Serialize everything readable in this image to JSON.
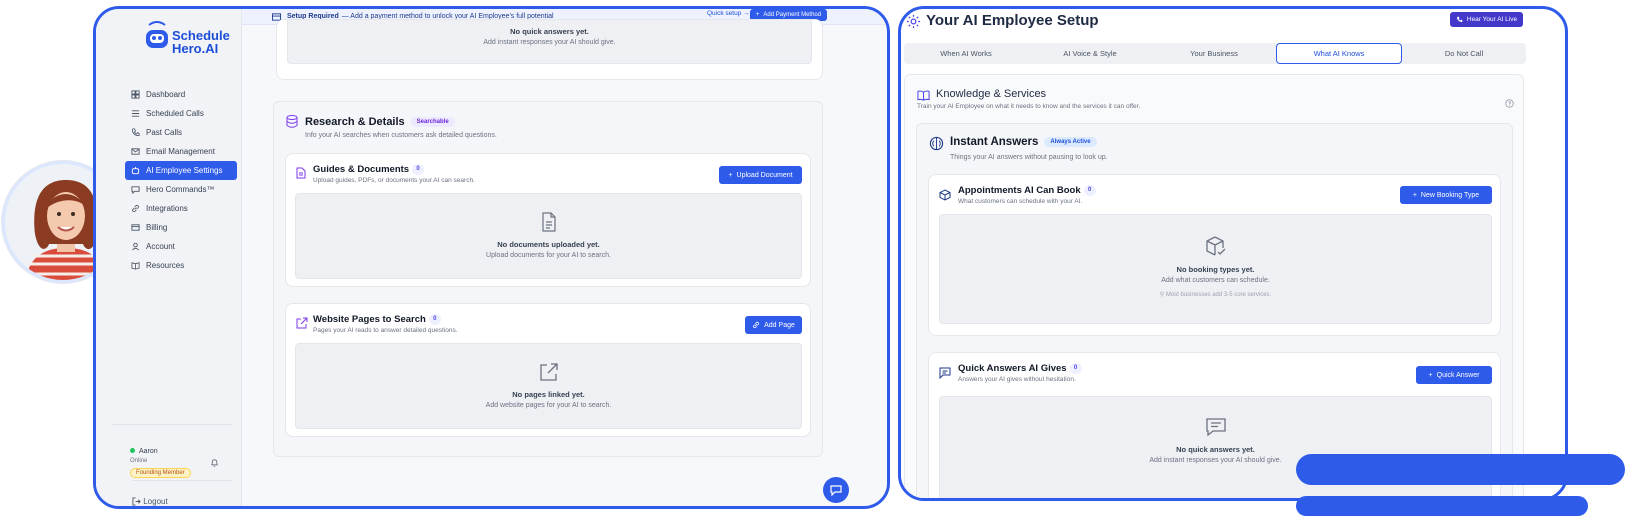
{
  "brand": {
    "line1": "Schedule",
    "line2": "Hero.AI"
  },
  "banner": {
    "title": "Setup Required",
    "text": "— Add a payment method to unlock your AI Employee's full potential",
    "quick_setup": "Quick setup →",
    "button": "Add Payment Method"
  },
  "sidebar": {
    "items": [
      {
        "label": "Dashboard",
        "icon": "dashboard-icon"
      },
      {
        "label": "Scheduled Calls",
        "icon": "list-icon"
      },
      {
        "label": "Past Calls",
        "icon": "phone-icon"
      },
      {
        "label": "Email Management",
        "icon": "mail-icon"
      },
      {
        "label": "AI Employee Settings",
        "icon": "robot-icon",
        "active": true
      },
      {
        "label": "Hero Commands™",
        "icon": "chat-icon"
      },
      {
        "label": "Integrations",
        "icon": "link-icon"
      },
      {
        "label": "Billing",
        "icon": "card-icon"
      },
      {
        "label": "Account",
        "icon": "user-icon"
      },
      {
        "label": "Resources",
        "icon": "book-icon"
      }
    ],
    "user": {
      "name": "Aaron",
      "status": "Online",
      "badge": "Founding Member"
    },
    "logout": "Logout"
  },
  "left": {
    "top_empty": {
      "title": "No quick answers yet.",
      "sub": "Add instant responses your AI should give."
    },
    "research": {
      "title": "Research & Details",
      "badge": "Searchable",
      "sub": "Info your AI searches when customers ask detailed questions."
    },
    "guides": {
      "title": "Guides & Documents",
      "count": "0",
      "sub": "Upload guides, PDFs, or documents your AI can search.",
      "button": "Upload Document",
      "empty_title": "No documents uploaded yet.",
      "empty_sub": "Upload documents for your AI to search."
    },
    "pages": {
      "title": "Website Pages to Search",
      "count": "0",
      "sub": "Pages your AI reads to answer detailed questions.",
      "button": "Add Page",
      "empty_title": "No pages linked yet.",
      "empty_sub": "Add website pages for your AI to search."
    }
  },
  "right": {
    "title": "Your AI Employee Setup",
    "hear_button": "Hear Your AI Live",
    "tabs": [
      "When AI Works",
      "AI Voice & Style",
      "Your Business",
      "What AI Knows",
      "Do Not Call"
    ],
    "knowledge": {
      "title": "Knowledge & Services",
      "sub": "Train your AI Employee on what it needs to know and the services it can offer."
    },
    "instant": {
      "title": "Instant Answers",
      "badge": "Always Active",
      "sub": "Things your AI answers without pausing to look up."
    },
    "appointments": {
      "title": "Appointments AI Can Book",
      "count": "0",
      "sub": "What customers can schedule with your AI.",
      "button": "New Booking Type",
      "empty_title": "No booking types yet.",
      "empty_sub": "Add what customers can schedule.",
      "hint": "Most businesses add 3-5 core services."
    },
    "quick": {
      "title": "Quick Answers AI Gives",
      "count": "0",
      "sub": "Answers your AI gives without hesitation.",
      "button": "Quick Answer",
      "empty_title": "No quick answers yet.",
      "empty_sub": "Add instant responses your AI should give."
    }
  },
  "colors": {
    "accent": "#2f5bea",
    "sidebar_bg": "#f1f3f7",
    "badge_purple": "#ede9fe"
  }
}
